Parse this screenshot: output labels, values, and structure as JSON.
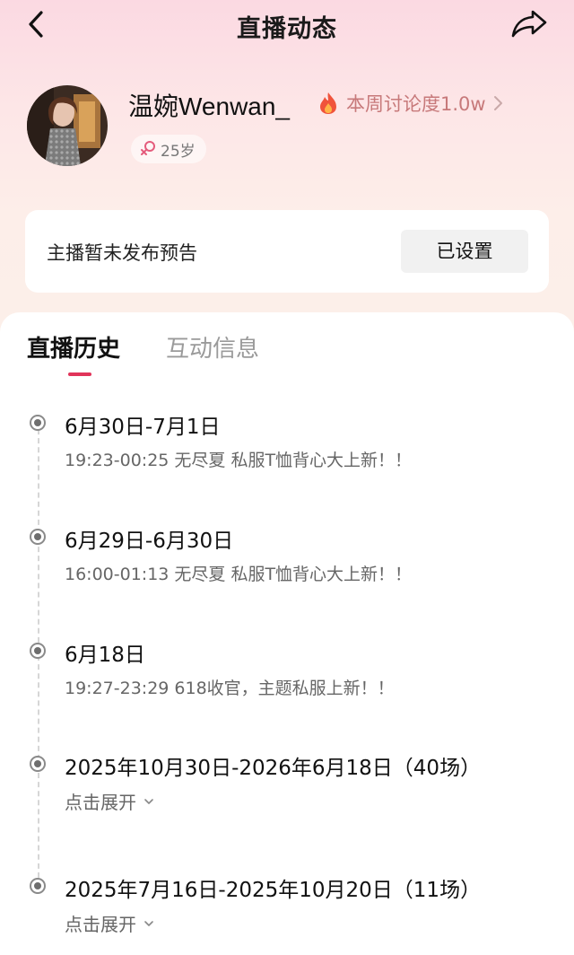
{
  "nav": {
    "title": "直播动态"
  },
  "profile": {
    "name": "温婉Wenwan_",
    "heat_label": "本周讨论度1.0w",
    "age": "25岁"
  },
  "notice": {
    "text": "主播暂未发布预告",
    "button": "已设置"
  },
  "tabs": [
    {
      "label": "直播历史",
      "active": true
    },
    {
      "label": "互动信息",
      "active": false
    }
  ],
  "history": [
    {
      "date": "6月30日-7月1日",
      "desc": "19:23-00:25 无尽夏 私服T恤背心大上新！！"
    },
    {
      "date": "6月29日-6月30日",
      "desc": "16:00-01:13 无尽夏 私服T恤背心大上新！！"
    },
    {
      "date": "6月18日",
      "desc": "19:27-23:29 618收官，主题私服上新！！"
    },
    {
      "date": "2025年10月30日-2026年6月18日（40场）",
      "expand": "点击展开"
    },
    {
      "date": "2025年7月16日-2025年10月20日（11场）",
      "expand": "点击展开"
    }
  ],
  "colors": {
    "accent": "#e1345a",
    "heat": "#c7797a"
  },
  "icons": [
    "back-arrow-icon",
    "share-icon",
    "flame-icon",
    "chevron-right-icon",
    "female-icon",
    "timeline-dot-icon",
    "chevron-down-icon"
  ]
}
